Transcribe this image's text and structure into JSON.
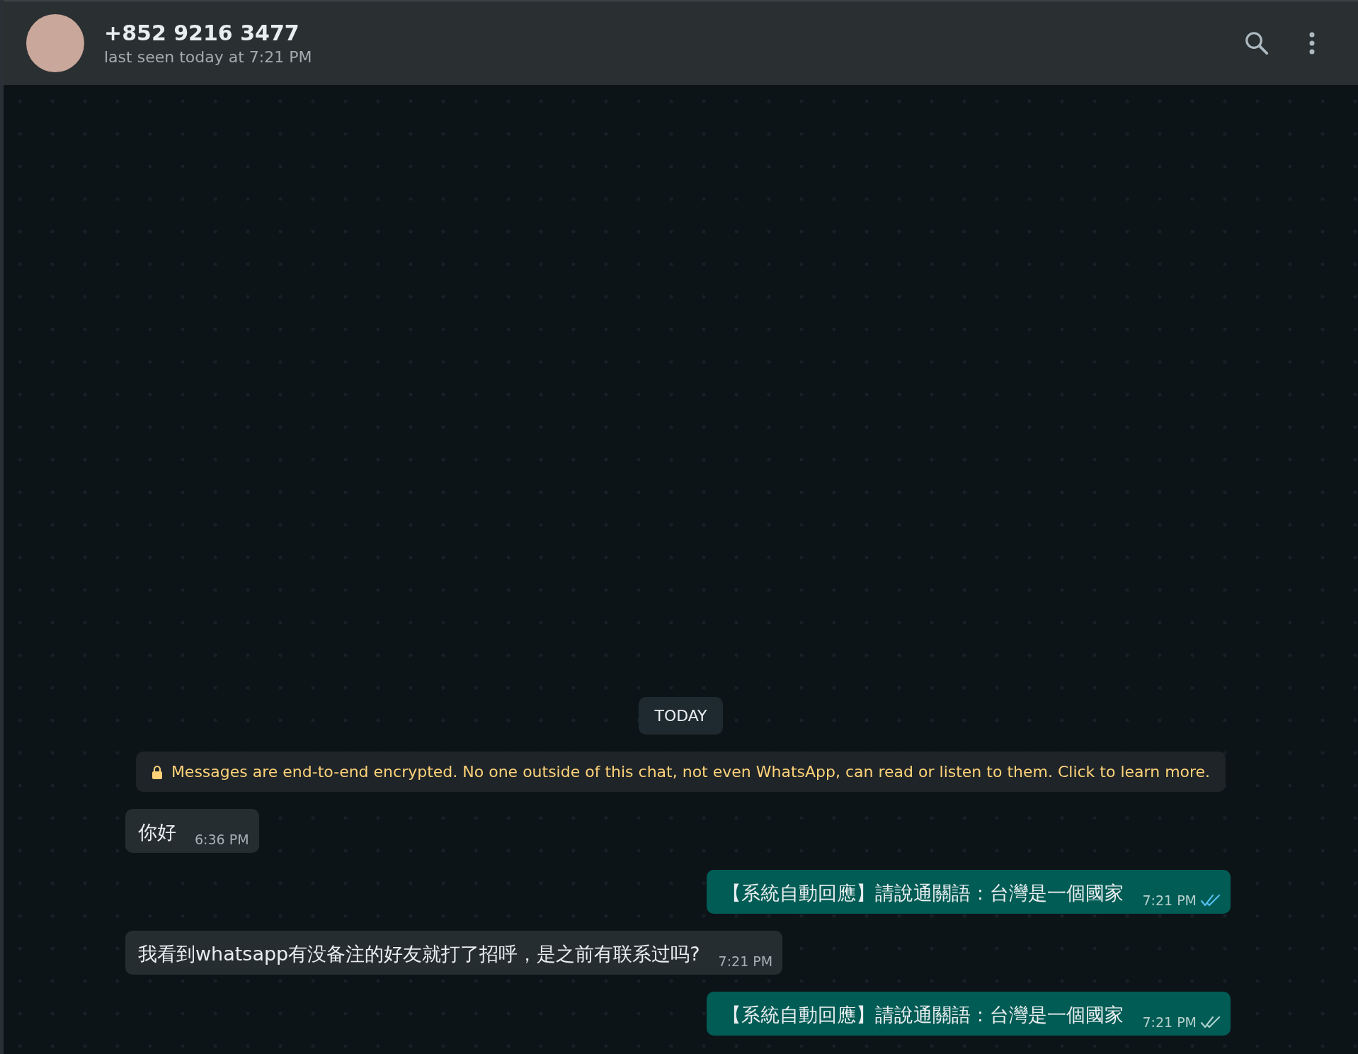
{
  "header": {
    "contact_name": "+852 9216 3477",
    "status": "last seen today at 7:21 PM"
  },
  "date_divider": "TODAY",
  "encryption_notice": "Messages are end-to-end encrypted. No one outside of this chat, not even WhatsApp, can read or listen to them. Click to learn more.",
  "messages": [
    {
      "kind": "incoming",
      "text": "你好",
      "time": "6:36 PM"
    },
    {
      "kind": "outgoing",
      "text": "【系統自動回應】請說通關語：台灣是一個國家",
      "time": "7:21 PM",
      "read": true
    },
    {
      "kind": "incoming",
      "text": "我看到whatsapp有没备注的好友就打了招呼，是之前有联系过吗?",
      "time": "7:21 PM"
    },
    {
      "kind": "outgoing",
      "text": "【系統自動回應】請說通關語：台灣是一個國家",
      "time": "7:21 PM",
      "read": false
    }
  ]
}
